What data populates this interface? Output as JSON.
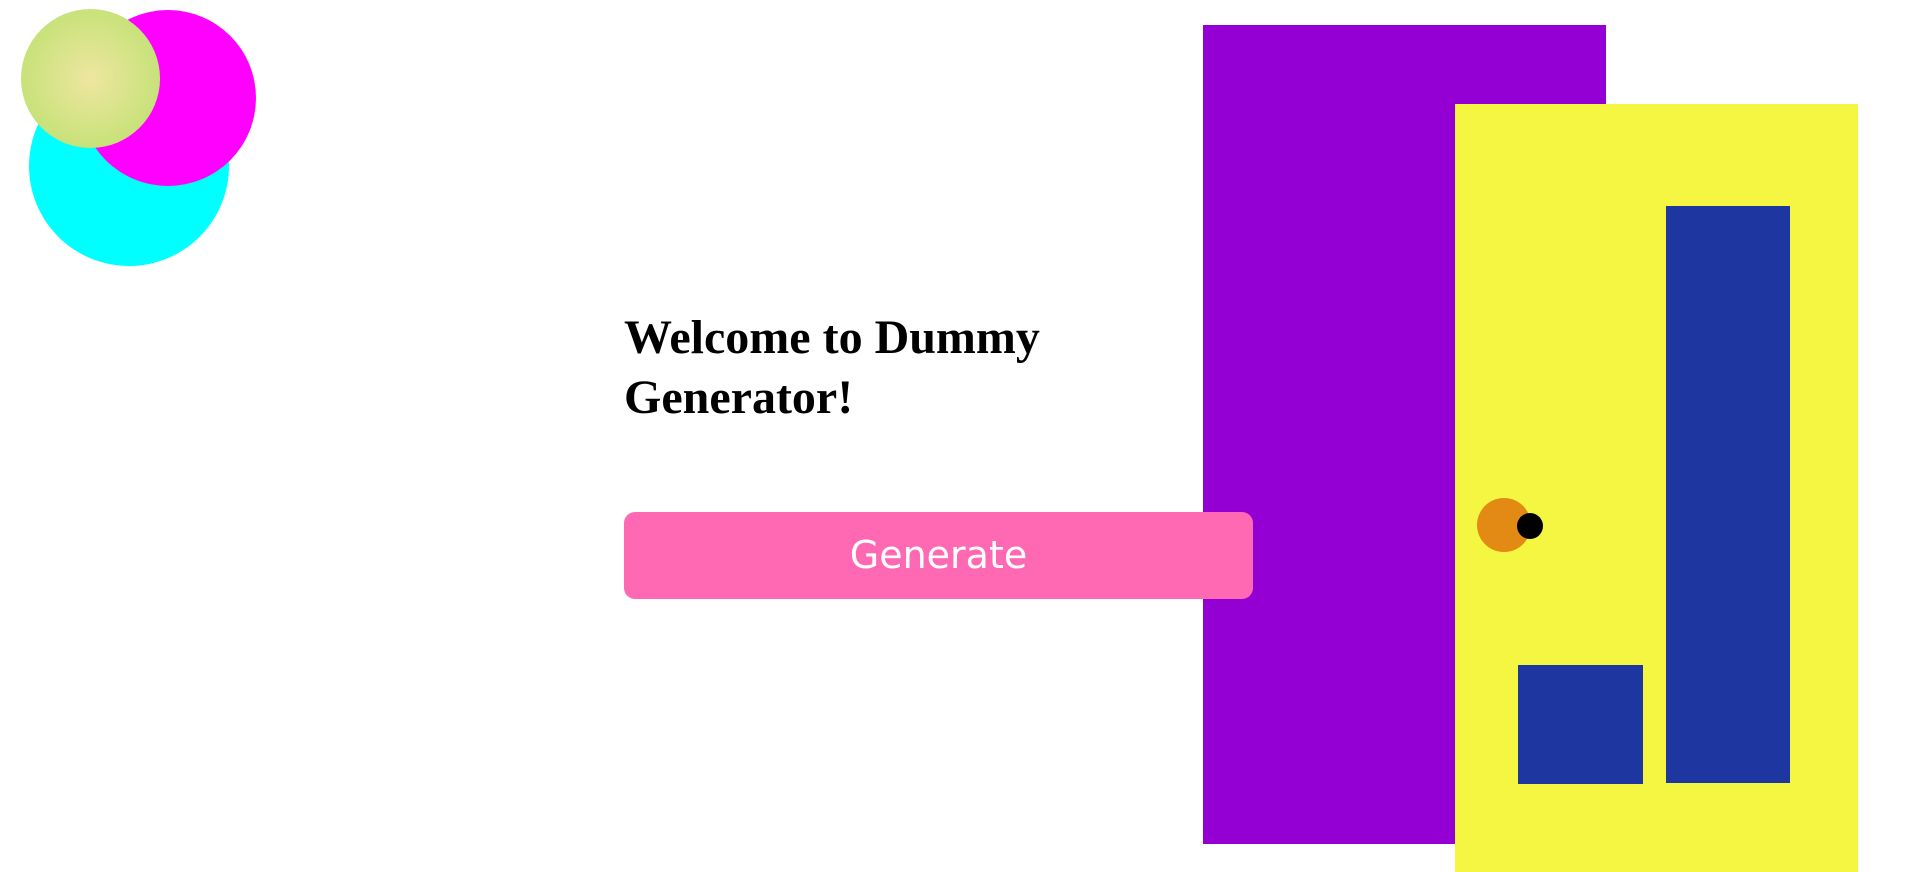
{
  "welcome": {
    "title": "Welcome to Dummy Generator!"
  },
  "actions": {
    "generate_label": "Generate"
  },
  "colors": {
    "background": "#ffffff",
    "button_bg": "#ff69b4",
    "button_text": "#ffffff",
    "circle_cyan": "#00ffff",
    "circle_magenta": "#ff00ff",
    "circle_green_center": "#eee6a0",
    "circle_green_edge": "#c8e27a",
    "door_frame": "#9400d3",
    "door_panel": "#f4f641",
    "door_windows": "#1e36a0",
    "door_knob_base": "#e28a14",
    "door_knob_dot": "#000000"
  },
  "decorations": {
    "icons": [
      "circle-cyan-icon",
      "circle-magenta-icon",
      "circle-green-icon",
      "door-icon"
    ]
  }
}
